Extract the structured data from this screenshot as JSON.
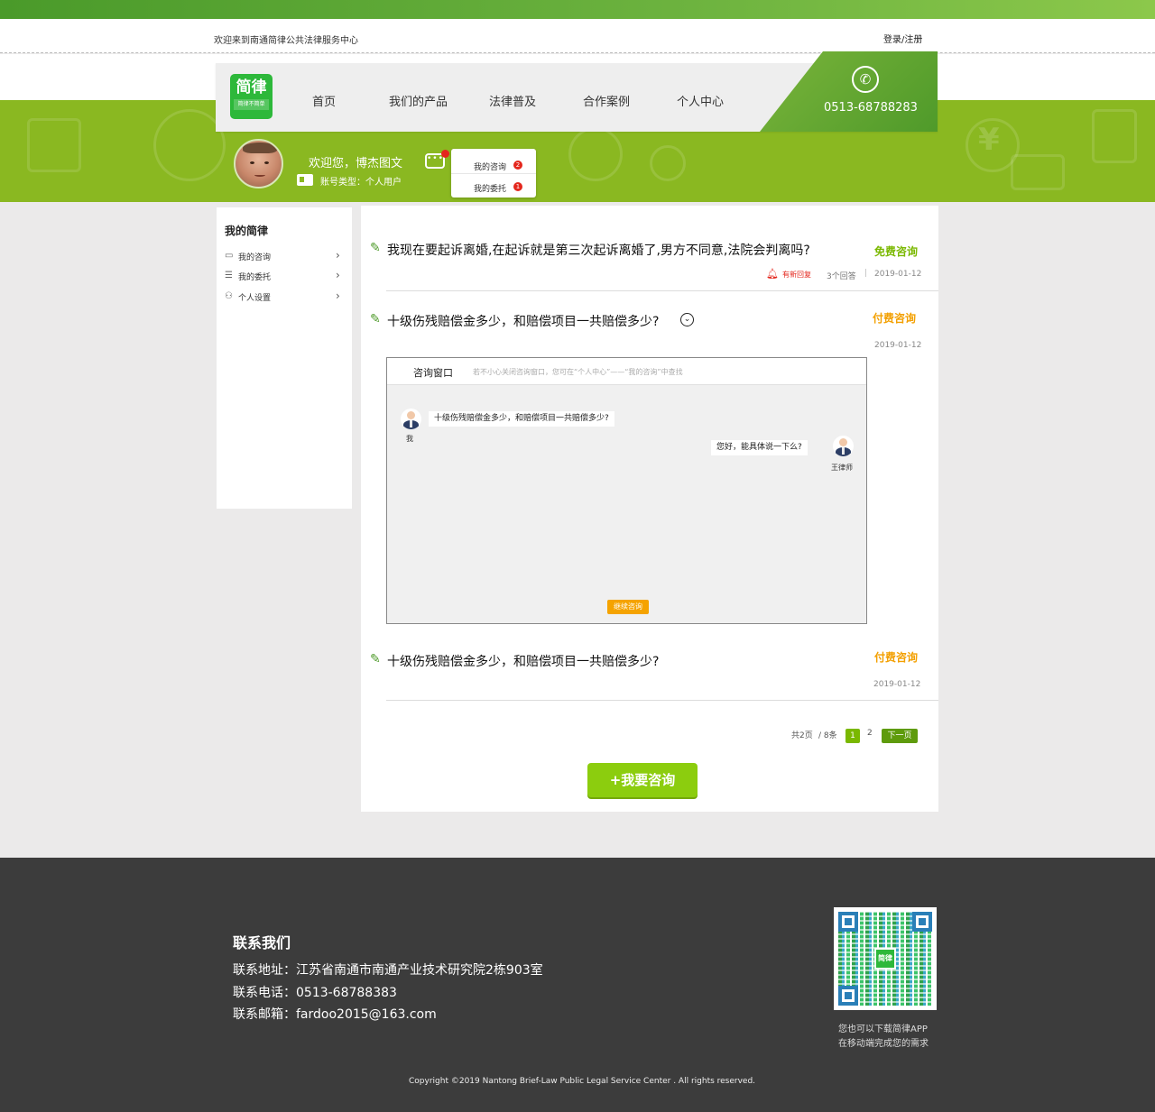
{
  "topbar": {
    "welcome": "欢迎来到南通简律公共法律服务中心",
    "login": "登录/注册"
  },
  "header": {
    "logo_main": "简律",
    "logo_sub": "简律不简单",
    "nav": [
      "首页",
      "我们的产品",
      "法律普及",
      "合作案例",
      "个人中心"
    ],
    "phone": "0513-68788283"
  },
  "user": {
    "greeting": "欢迎您，博杰图文",
    "account_type": "账号类型：个人用户",
    "menu": [
      {
        "label": "我的咨询",
        "badge": "2"
      },
      {
        "label": "我的委托",
        "badge": "1"
      }
    ]
  },
  "sidebar": {
    "title": "我的简律",
    "items": [
      "我的咨询",
      "我的委托",
      "个人设置"
    ]
  },
  "questions": [
    {
      "title": "我现在要起诉离婚,在起诉就是第三次起诉离婚了,男方不同意,法院会判离吗?",
      "type": "免费咨询",
      "new_reply": "有新回复",
      "answers": "3个回答",
      "separator": "|",
      "date": "2019-01-12"
    },
    {
      "title": "十级伤残赔偿金多少，和赔偿项目一共赔偿多少?",
      "type": "付费咨询",
      "date": "2019-01-12"
    },
    {
      "title": "十级伤残赔偿金多少，和赔偿项目一共赔偿多少?",
      "type": "付费咨询",
      "date": "2019-01-12"
    }
  ],
  "chat": {
    "tab": "咨询窗口",
    "hint": "若不小心关闭咨询窗口，您可在“个人中心”——“我的咨询”中查找",
    "messages": [
      {
        "sender": "我",
        "text": "十级伤残赔偿金多少，和赔偿项目一共赔偿多少?"
      },
      {
        "sender": "王律师",
        "text": "您好，能具体说一下么?"
      }
    ],
    "continue": "继续咨询"
  },
  "pager": {
    "total_pages": "共2页",
    "total_items": "/ 8条",
    "current": "1",
    "next_page": "2",
    "next_label": "下一页"
  },
  "ask_button": "+我要咨询",
  "footer": {
    "title": "联系我们",
    "address": "联系地址：江苏省南通市南通产业技术研究院2栋903室",
    "phone": "联系电话：0513-68788383",
    "email": "联系邮箱：fardoo2015@163.com",
    "qr_logo": "简律",
    "qr_line1": "您也可以下载简律APP",
    "qr_line2": "在移动端完成您的需求",
    "copyright": "Copyright ©2019   Nantong Brief-Law Public Legal Service Center .   All rights reserved."
  },
  "colors": {
    "brand_green": "#8ab821",
    "paid_orange": "#f3a000",
    "free_green": "#7ab800",
    "alert_red": "#e4271d"
  }
}
